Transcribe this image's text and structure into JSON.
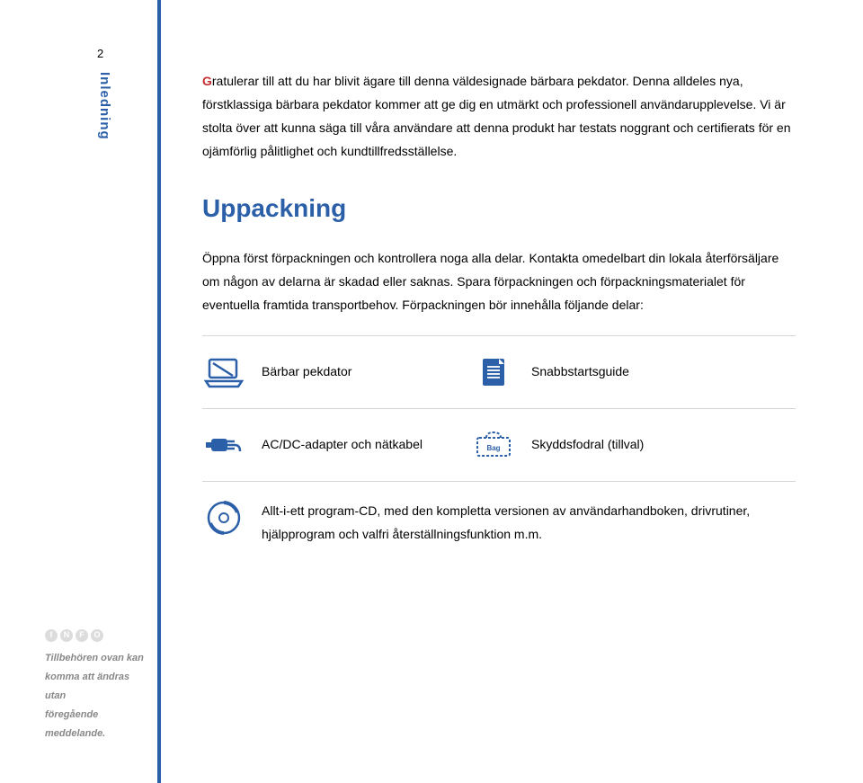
{
  "page_number": "2",
  "sidebar_heading": "Inledning",
  "intro": {
    "initial": "G",
    "text_after_initial": "ratulerar till att du har blivit ägare till denna väldesignade bärbara pekdator.   Denna alldeles nya, förstklassiga bärbara pekdator kommer att ge dig en utmärkt och professionell användarupplevelse. Vi är stolta över att kunna säga till våra användare att denna produkt har testats noggrant och certifierats för en ojämförlig pålitlighet och kundtillfredsställelse."
  },
  "section_title": "Uppackning",
  "section_body": "Öppna först förpackningen och kontrollera noga alla delar.   Kontakta omedelbart din lokala återförsäljare om någon av delarna är skadad eller saknas.   Spara förpackningen och förpackningsmaterialet för eventuella framtida transportbehov.   Förpackningen bör innehålla följande delar:",
  "items": {
    "row1": {
      "left": "Bärbar pekdator",
      "right": "Snabbstartsguide"
    },
    "row2": {
      "left": "AC/DC-adapter och nätkabel",
      "right": "Skyddsfodral (tillval)"
    },
    "row3": {
      "text": "Allt-i-ett program-CD, med den kompletta versionen av användarhandboken, drivrutiner, hjälpprogram och valfri återställningsfunktion m.m."
    }
  },
  "info_note": {
    "line1": "Tillbehören ovan kan",
    "line2": "komma att ändras utan",
    "line3": "föregående meddelande."
  }
}
